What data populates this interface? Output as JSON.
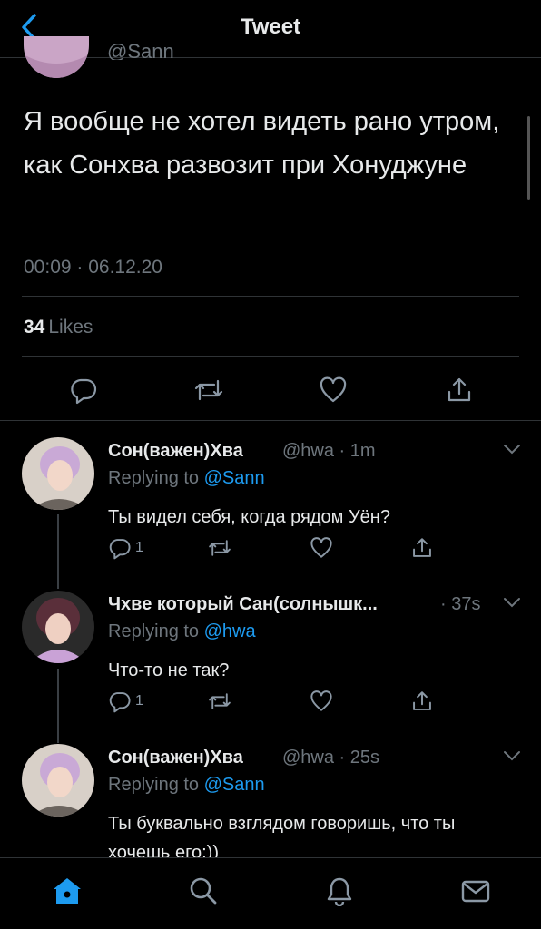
{
  "header": {
    "title": "Tweet"
  },
  "tweet": {
    "handle_partial": "@Sann",
    "text": "Я вообще не хотел видеть рано утром, как Сонхва развозит при Хонуджуне",
    "timestamp": "00:09 · 06.12.20",
    "likes_count": "34",
    "likes_label": "Likes"
  },
  "replies": [
    {
      "name": "Сон(важен)Хва",
      "handle_time": "@hwa · 1m",
      "replying_prefix": "Replying to",
      "replying_to": "@Sann",
      "text": "Ты видел себя, когда рядом Уён?",
      "reply_count": "1"
    },
    {
      "name": "Чхве который Сан(солнышк...",
      "handle_time": "· 37s",
      "replying_prefix": "Replying to",
      "replying_to": "@hwa",
      "text": "Что-то не так?",
      "reply_count": "1"
    },
    {
      "name": "Сон(важен)Хва",
      "handle_time": "@hwa · 25s",
      "replying_prefix": "Replying to",
      "replying_to": "@Sann",
      "text": "Ты буквально взглядом говоришь, что ты хочешь его:))"
    }
  ],
  "icons": {
    "back": "chevron-left-icon",
    "reply": "reply-bubble-icon",
    "retweet": "retweet-icon",
    "like": "heart-icon",
    "share": "share-icon",
    "home": "home-icon",
    "search": "search-icon",
    "notifications": "bell-icon",
    "messages": "mail-icon"
  },
  "colors": {
    "accent": "#1d9bf0",
    "background": "#000000",
    "text": "#e7e9ea",
    "secondary": "#6e767d",
    "divider": "#2f3336"
  }
}
